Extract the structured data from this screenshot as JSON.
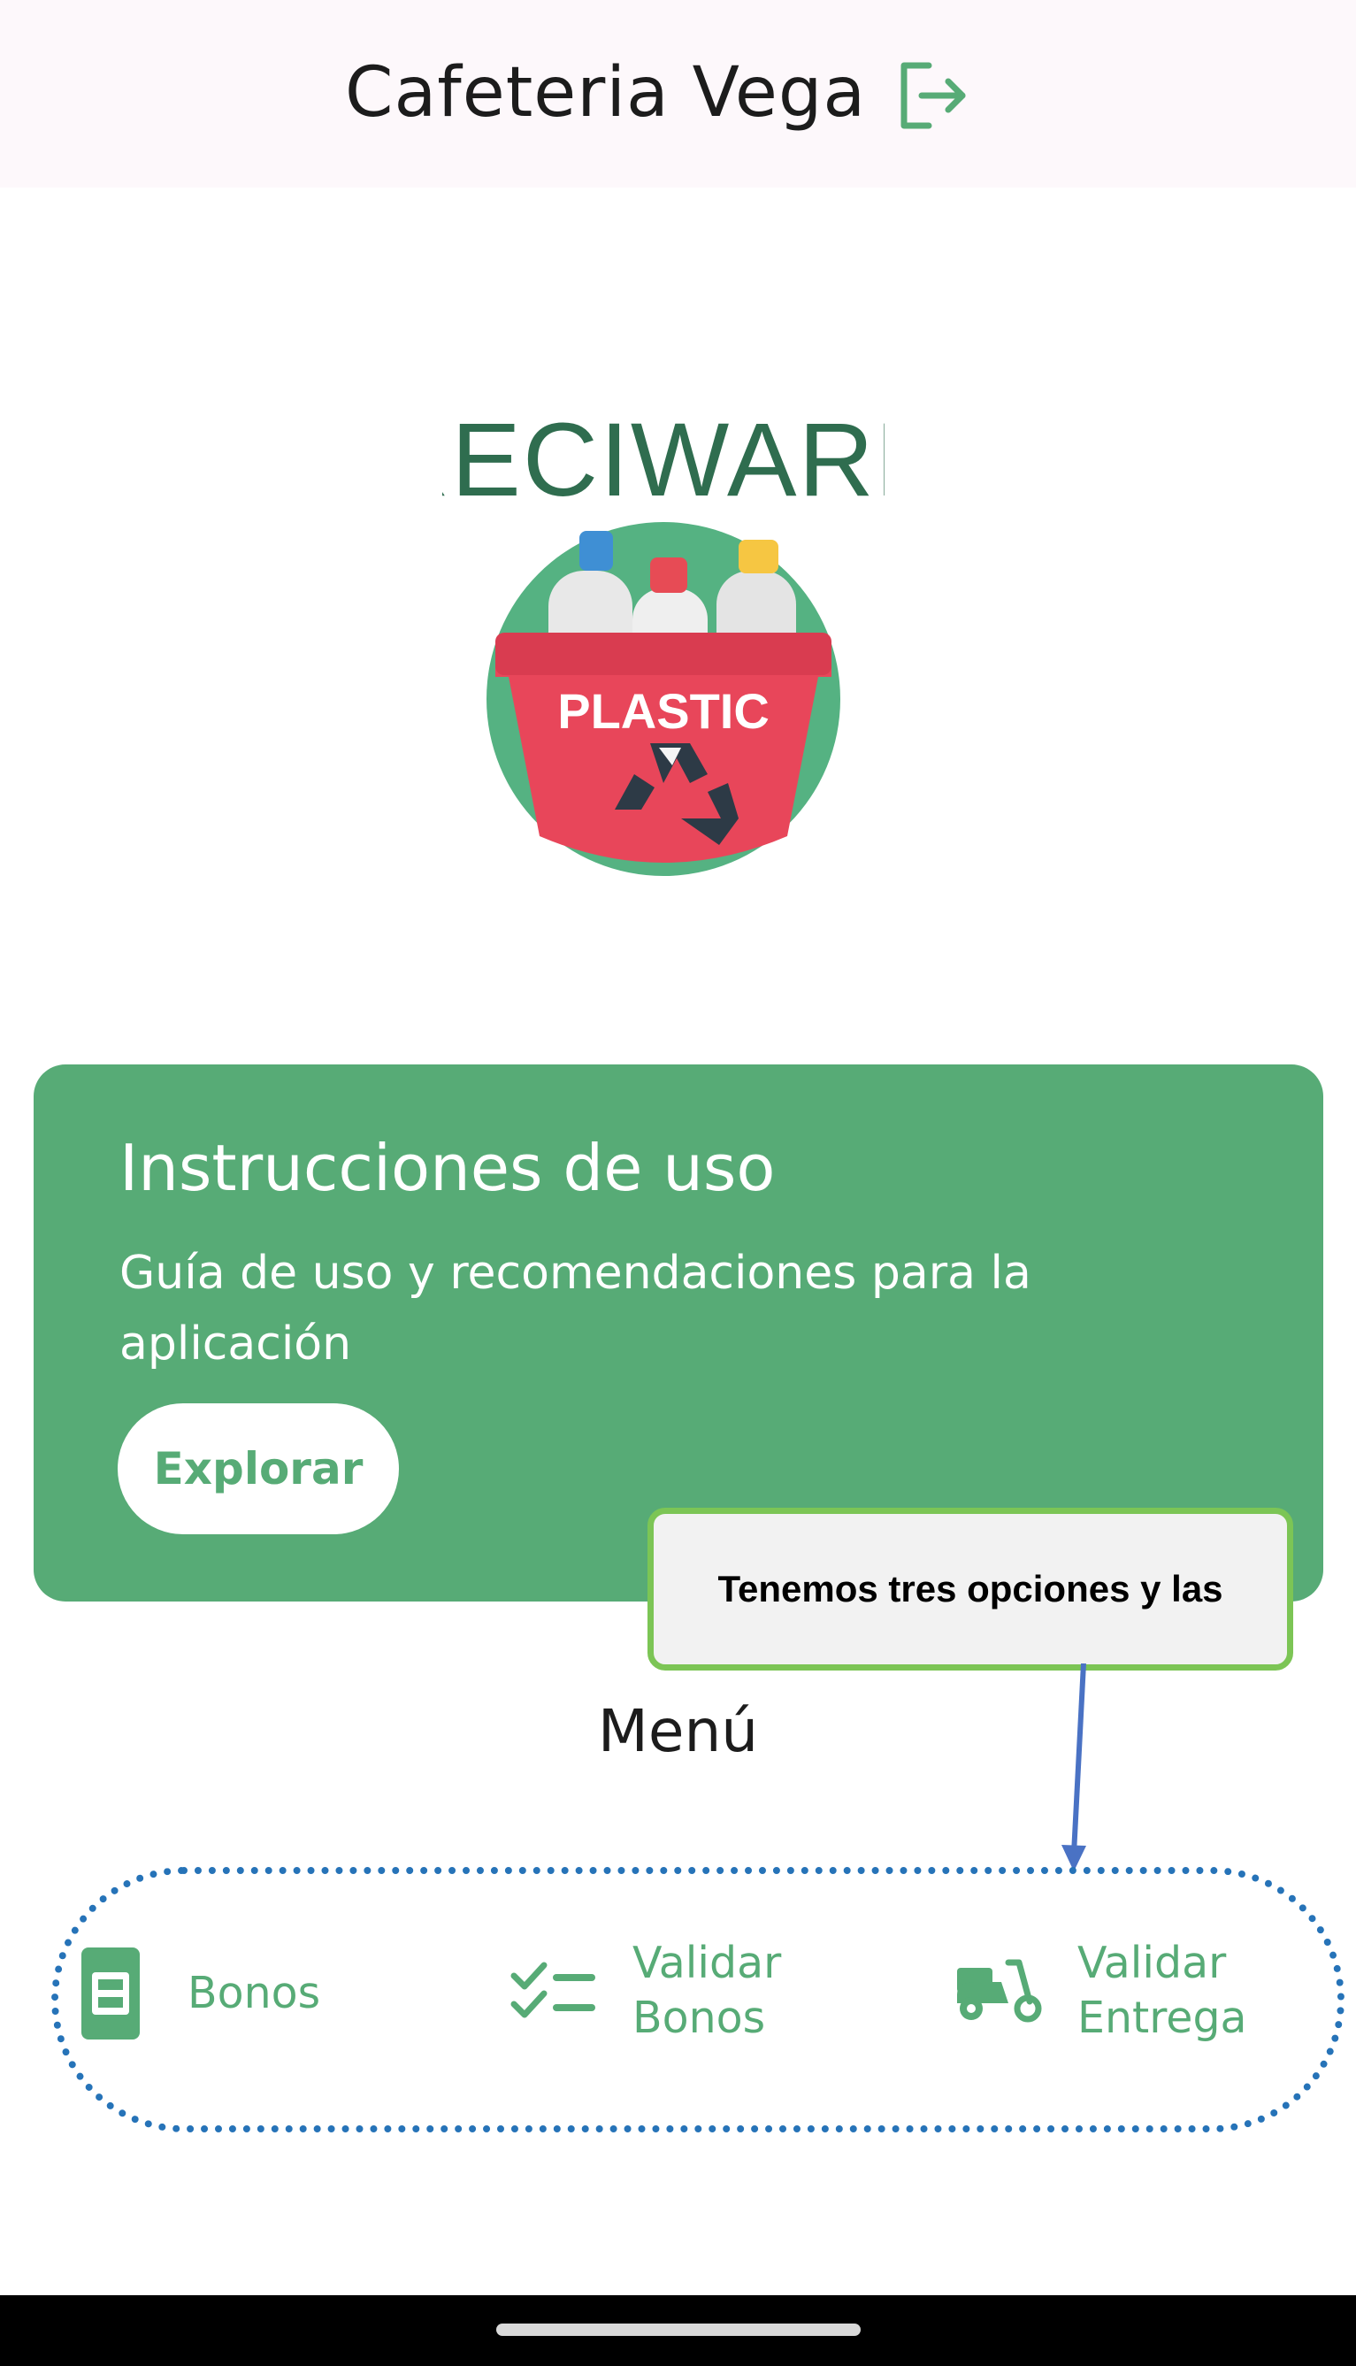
{
  "header": {
    "title": "Cafeteria Vega"
  },
  "logo": {
    "brand_text": "RECIWARD",
    "bucket_text": "PLASTIC"
  },
  "card": {
    "title": "Instrucciones de uso",
    "subtitle": "Guía de uso y recomendaciones para la aplicación",
    "button_label": "Explorar"
  },
  "callout": {
    "text": "Tenemos tres opciones y las"
  },
  "menu": {
    "title": "Menú",
    "items": [
      {
        "label": "Bonos",
        "icon": "ticket-icon"
      },
      {
        "label_line1": "Validar",
        "label_line2": "Bonos",
        "icon": "checklist-icon"
      },
      {
        "label_line1": "Validar",
        "label_line2": "Entrega",
        "icon": "scooter-icon"
      }
    ]
  },
  "colors": {
    "accent": "#57ab76",
    "dark_green": "#2f6d4f",
    "callout_border": "#7cc555",
    "dotted_outline": "#2673b8"
  }
}
